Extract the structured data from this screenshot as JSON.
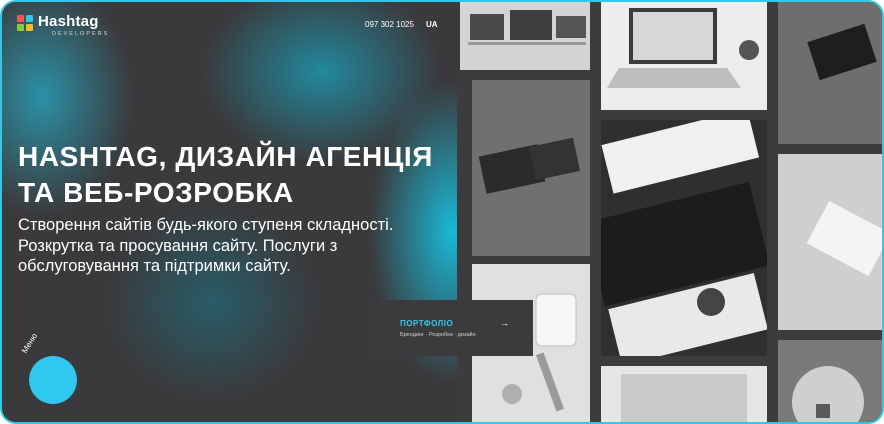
{
  "brand": {
    "name": "Hashtag",
    "tagline": "DEVELOPERS"
  },
  "header": {
    "phone": "097 302 1025",
    "language": "UA"
  },
  "hero": {
    "title": "HASHTAG, ДИЗАЙН АГЕНЦІЯ ТА ВЕБ-РОЗРОБКА",
    "subtitle": "Створення сайтів будь-якого ступеня складності. Розкрутка та просування сайту. Послуги з обслуговування та підтримки сайту."
  },
  "menu": {
    "label": "Меню"
  },
  "portfolio": {
    "title": "ПОРТФОЛІО",
    "arrow": "→",
    "tags": "Брендинг · Розробка · дизайн"
  },
  "colors": {
    "accent": "#35c6e6",
    "background": "#3a3a3c"
  },
  "icons": {
    "logo": "hashtag-logo-icon",
    "arrow": "arrow-right-icon"
  }
}
